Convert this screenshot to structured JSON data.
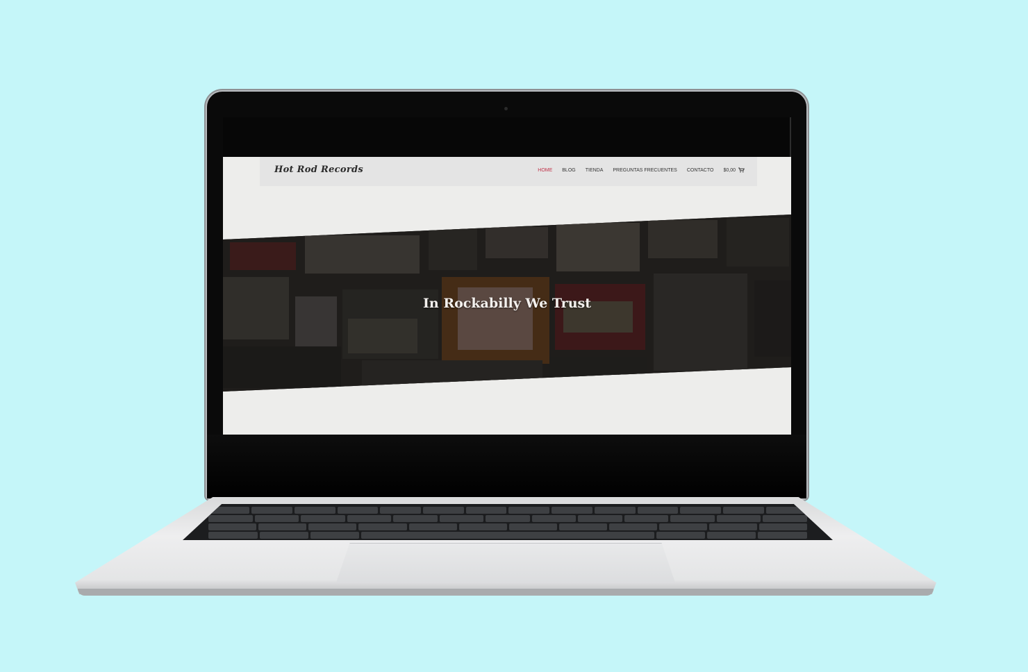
{
  "site": {
    "logo": "Hot Rod Records",
    "nav": [
      {
        "label": "HOME",
        "active": true
      },
      {
        "label": "BLOG",
        "active": false
      },
      {
        "label": "TIENDA",
        "active": false
      },
      {
        "label": "PREGUNTAS FRECUENTES",
        "active": false
      },
      {
        "label": "CONTACTO",
        "active": false
      }
    ],
    "cart_total": "$0,00",
    "hero_title": "In Rockabilly We Trust"
  },
  "colors": {
    "background": "#c5f6f9",
    "accent": "#c0334a",
    "nav_bg": "#e4e4e4"
  },
  "icons": {
    "cart": "cart-icon"
  }
}
